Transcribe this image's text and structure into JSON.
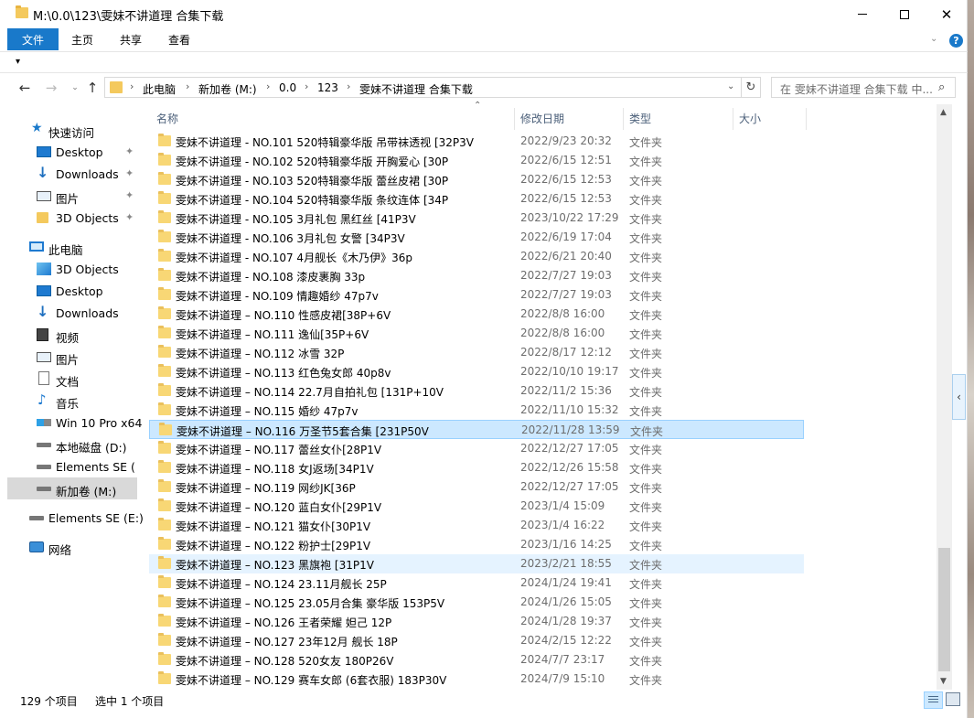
{
  "window": {
    "title": "M:\\0.0\\123\\雯妹不讲道理 合集下载",
    "minimize_glyph": "",
    "maximize_glyph": "",
    "close_glyph": "✕"
  },
  "ribbon": {
    "tabs": [
      "文件",
      "主页",
      "共享",
      "查看"
    ],
    "collapse_glyph": "⌄",
    "help_glyph": "?"
  },
  "nav": {
    "back_glyph": "←",
    "forward_glyph": "→",
    "recent_glyph": "⌄",
    "up_glyph": "↑",
    "crumbs": [
      "此电脑",
      "新加卷 (M:)",
      "0.0",
      "123",
      "雯妹不讲道理 合集下载"
    ],
    "separator": "›",
    "dropdown_glyph": "⌄",
    "refresh_glyph": "↻",
    "search_placeholder": "在 雯妹不讲道理 合集下载 中...",
    "search_glyph": "⌕"
  },
  "sidebar": {
    "pin_glyph": "✦",
    "items": [
      {
        "label": "快速访问",
        "icon": "star-icon",
        "glyph": "★"
      },
      {
        "label": "Desktop",
        "icon": "desktop-icon",
        "glyph": ""
      },
      {
        "label": "Downloads",
        "icon": "download-icon",
        "glyph": "↓"
      },
      {
        "label": "图片",
        "icon": "pictures-icon",
        "glyph": ""
      },
      {
        "label": "3D Objects",
        "icon": "folder-icon",
        "glyph": ""
      },
      {
        "label": "此电脑",
        "icon": "computer-icon",
        "glyph": ""
      },
      {
        "label": "3D Objects",
        "icon": "3d-objects-icon",
        "glyph": ""
      },
      {
        "label": "Desktop",
        "icon": "desktop-icon",
        "glyph": ""
      },
      {
        "label": "Downloads",
        "icon": "download-icon",
        "glyph": "↓"
      },
      {
        "label": "视频",
        "icon": "video-icon",
        "glyph": ""
      },
      {
        "label": "图片",
        "icon": "pictures-icon",
        "glyph": ""
      },
      {
        "label": "文档",
        "icon": "documents-icon",
        "glyph": ""
      },
      {
        "label": "音乐",
        "icon": "music-icon",
        "glyph": "♪"
      },
      {
        "label": "Win 10 Pro x64",
        "icon": "windows-drive-icon",
        "glyph": ""
      },
      {
        "label": "本地磁盘 (D:)",
        "icon": "drive-icon",
        "glyph": ""
      },
      {
        "label": "Elements SE (E:)",
        "icon": "drive-icon",
        "glyph": ""
      },
      {
        "label": "新加卷 (M:)",
        "icon": "drive-icon",
        "glyph": ""
      },
      {
        "label": "Elements SE (E:)",
        "icon": "drive-icon",
        "glyph": ""
      },
      {
        "label": "网络",
        "icon": "network-icon",
        "glyph": ""
      }
    ]
  },
  "columns": {
    "sort_glyph": "⌃",
    "headers": [
      "名称",
      "修改日期",
      "类型",
      "大小"
    ]
  },
  "files": [
    {
      "name": "雯妹不讲道理 - NO.101 520特辑豪华版 吊带袜透视 [32P3V",
      "date": "2022/9/23 20:32",
      "type": "文件夹"
    },
    {
      "name": "雯妹不讲道理 - NO.102 520特辑豪华版 开胸爱心 [30P",
      "date": "2022/6/15 12:51",
      "type": "文件夹"
    },
    {
      "name": "雯妹不讲道理 - NO.103 520特辑豪华版 蕾丝皮裙 [30P",
      "date": "2022/6/15 12:53",
      "type": "文件夹"
    },
    {
      "name": "雯妹不讲道理 - NO.104 520特辑豪华版 条纹连体 [34P",
      "date": "2022/6/15 12:53",
      "type": "文件夹"
    },
    {
      "name": "雯妹不讲道理 - NO.105 3月礼包 黑红丝 [41P3V",
      "date": "2023/10/22 17:29",
      "type": "文件夹"
    },
    {
      "name": "雯妹不讲道理 - NO.106 3月礼包 女警 [34P3V",
      "date": "2022/6/19 17:04",
      "type": "文件夹"
    },
    {
      "name": "雯妹不讲道理 - NO.107 4月舰长《木乃伊》36p",
      "date": "2022/6/21 20:40",
      "type": "文件夹"
    },
    {
      "name": "雯妹不讲道理 - NO.108 漆皮裹胸 33p",
      "date": "2022/7/27 19:03",
      "type": "文件夹"
    },
    {
      "name": "雯妹不讲道理 - NO.109 情趣婚纱 47p7v",
      "date": "2022/7/27 19:03",
      "type": "文件夹"
    },
    {
      "name": "雯妹不讲道理 – NO.110 性感皮裙[38P+6V",
      "date": "2022/8/8 16:00",
      "type": "文件夹"
    },
    {
      "name": "雯妹不讲道理 – NO.111 逸仙[35P+6V",
      "date": "2022/8/8 16:00",
      "type": "文件夹"
    },
    {
      "name": "雯妹不讲道理 – NO.112 冰雪 32P",
      "date": "2022/8/17 12:12",
      "type": "文件夹"
    },
    {
      "name": "雯妹不讲道理 – NO.113 红色兔女郎 40p8v",
      "date": "2022/10/10 19:17",
      "type": "文件夹"
    },
    {
      "name": "雯妹不讲道理 – NO.114 22.7月自拍礼包 [131P+10V",
      "date": "2022/11/2 15:36",
      "type": "文件夹"
    },
    {
      "name": "雯妹不讲道理 – NO.115 婚纱 47p7v",
      "date": "2022/11/10 15:32",
      "type": "文件夹"
    },
    {
      "name": "雯妹不讲道理 – NO.116 万圣节5套合集 [231P50V",
      "date": "2022/11/28 13:59",
      "type": "文件夹"
    },
    {
      "name": "雯妹不讲道理 – NO.117 蕾丝女仆[28P1V",
      "date": "2022/12/27 17:05",
      "type": "文件夹"
    },
    {
      "name": "雯妹不讲道理 – NO.118 女J返场[34P1V",
      "date": "2022/12/26 15:58",
      "type": "文件夹"
    },
    {
      "name": "雯妹不讲道理 – NO.119 网纱JK[36P",
      "date": "2022/12/27 17:05",
      "type": "文件夹"
    },
    {
      "name": "雯妹不讲道理 – NO.120 蓝白女仆[29P1V",
      "date": "2023/1/4 15:09",
      "type": "文件夹"
    },
    {
      "name": "雯妹不讲道理 – NO.121 猫女仆[30P1V",
      "date": "2023/1/4 16:22",
      "type": "文件夹"
    },
    {
      "name": "雯妹不讲道理 – NO.122 粉护士[29P1V",
      "date": "2023/1/16 14:25",
      "type": "文件夹"
    },
    {
      "name": "雯妹不讲道理 – NO.123 黑旗袍 [31P1V",
      "date": "2023/2/21 18:55",
      "type": "文件夹"
    },
    {
      "name": "雯妹不讲道理 – NO.124 23.11月舰长 25P",
      "date": "2024/1/24 19:41",
      "type": "文件夹"
    },
    {
      "name": "雯妹不讲道理 – NO.125 23.05月合集 豪华版 153P5V",
      "date": "2024/1/26 15:05",
      "type": "文件夹"
    },
    {
      "name": "雯妹不讲道理 – NO.126 王者荣耀 妲己 12P",
      "date": "2024/1/28 19:37",
      "type": "文件夹"
    },
    {
      "name": "雯妹不讲道理 – NO.127 23年12月  舰长 18P",
      "date": "2024/2/15 12:22",
      "type": "文件夹"
    },
    {
      "name": "雯妹不讲道理 – NO.128 520女友 180P26V",
      "date": "2024/7/7 23:17",
      "type": "文件夹"
    },
    {
      "name": "雯妹不讲道理 – NO.129 赛车女郎 (6套衣服) 183P30V",
      "date": "2024/7/9 15:10",
      "type": "文件夹"
    }
  ],
  "scrollbar": {
    "up_glyph": "▲",
    "down_glyph": "▼",
    "preview_toggle_glyph": "‹"
  },
  "status": {
    "count": "129 个项目",
    "selected": "选中 1 个项目"
  }
}
